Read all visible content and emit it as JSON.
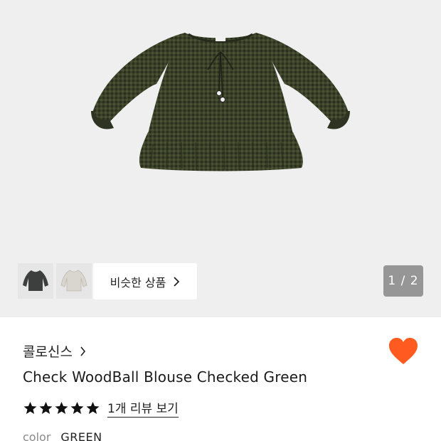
{
  "gallery": {
    "image_alt": "Check WoodBall Blouse Checked Green",
    "thumbnails": [
      {
        "name": "thumbnail-dark-blouse"
      },
      {
        "name": "thumbnail-light-blouse"
      }
    ],
    "similar_button_label": "비슷한 상품",
    "counter": "1 / 2"
  },
  "product": {
    "brand": "콜로신스",
    "title": "Check WoodBall Blouse Checked Green",
    "rating": 5,
    "rating_max": 5,
    "review_link": "1개 리뷰 보기",
    "option_label": "color",
    "option_value": "GREEN",
    "wishlisted": true
  },
  "colors": {
    "heart": "#ff5a1f",
    "gallery_bg": "#efefef",
    "blouse": "#3a4229"
  }
}
